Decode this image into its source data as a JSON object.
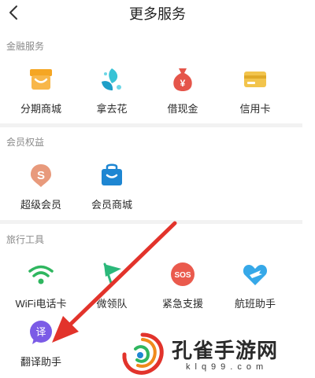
{
  "header": {
    "title": "更多服务"
  },
  "sections": [
    {
      "title": "金融服务",
      "items": [
        {
          "label": "分期商城",
          "icon": "shop-icon"
        },
        {
          "label": "拿去花",
          "icon": "flower-icon"
        },
        {
          "label": "借现金",
          "icon": "money-bag-icon"
        },
        {
          "label": "信用卡",
          "icon": "credit-card-icon"
        }
      ]
    },
    {
      "title": "会员权益",
      "items": [
        {
          "label": "超级会员",
          "icon": "super-vip-icon"
        },
        {
          "label": "会员商城",
          "icon": "member-bag-icon"
        }
      ]
    },
    {
      "title": "旅行工具",
      "items": [
        {
          "label": "WiFi电话卡",
          "icon": "wifi-icon"
        },
        {
          "label": "微领队",
          "icon": "flag-icon"
        },
        {
          "label": "紧急支援",
          "icon": "sos-icon"
        },
        {
          "label": "航班助手",
          "icon": "plane-heart-icon"
        },
        {
          "label": "翻译助手",
          "icon": "translate-icon"
        }
      ]
    }
  ],
  "watermark": {
    "title": "孔雀手游网",
    "url": "klq99.com"
  },
  "colors": {
    "accent": "#e2332b",
    "section_title": "#8a8a8a",
    "divider": "#f2f2f2"
  }
}
